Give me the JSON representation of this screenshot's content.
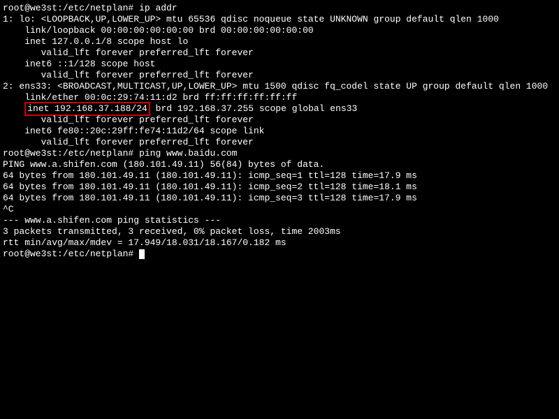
{
  "prompt1": "root@we3st:/etc/netplan# ",
  "cmd1": "ip addr",
  "iface1": {
    "header": "1: lo: <LOOPBACK,UP,LOWER_UP> mtu 65536 qdisc noqueue state UNKNOWN group default qlen 1000",
    "link": "    link/loopback 00:00:00:00:00:00 brd 00:00:00:00:00:00",
    "inet": "    inet 127.0.0.1/8 scope host lo",
    "valid1": "       valid_lft forever preferred_lft forever",
    "inet6": "    inet6 ::1/128 scope host",
    "valid2": "       valid_lft forever preferred_lft forever"
  },
  "iface2": {
    "header": "2: ens33: <BROADCAST,MULTICAST,UP,LOWER_UP> mtu 1500 qdisc fq_codel state UP group default qlen 1000",
    "link": "    link/ether 00:0c:29:74:11:d2 brd ff:ff:ff:ff:ff:ff",
    "inet_prefix": "    ",
    "inet_highlighted": "inet 192.168.37.188/24",
    "inet_suffix": " brd 192.168.37.255 scope global ens33",
    "valid1": "       valid_lft forever preferred_lft forever",
    "inet6": "    inet6 fe80::20c:29ff:fe74:11d2/64 scope link",
    "valid2": "       valid_lft forever preferred_lft forever"
  },
  "prompt2": "root@we3st:/etc/netplan# ",
  "cmd2": "ping www.baidu.com",
  "ping": {
    "header": "PING www.a.shifen.com (180.101.49.11) 56(84) bytes of data.",
    "reply1": "64 bytes from 180.101.49.11 (180.101.49.11): icmp_seq=1 ttl=128 time=17.9 ms",
    "reply2": "64 bytes from 180.101.49.11 (180.101.49.11): icmp_seq=2 ttl=128 time=18.1 ms",
    "reply3": "64 bytes from 180.101.49.11 (180.101.49.11): icmp_seq=3 ttl=128 time=17.9 ms",
    "interrupt": "^C",
    "stats_header": "--- www.a.shifen.com ping statistics ---",
    "stats1": "3 packets transmitted, 3 received, 0% packet loss, time 2003ms",
    "stats2": "rtt min/avg/max/mdev = 17.949/18.031/18.167/0.182 ms"
  },
  "prompt3": "root@we3st:/etc/netplan# "
}
